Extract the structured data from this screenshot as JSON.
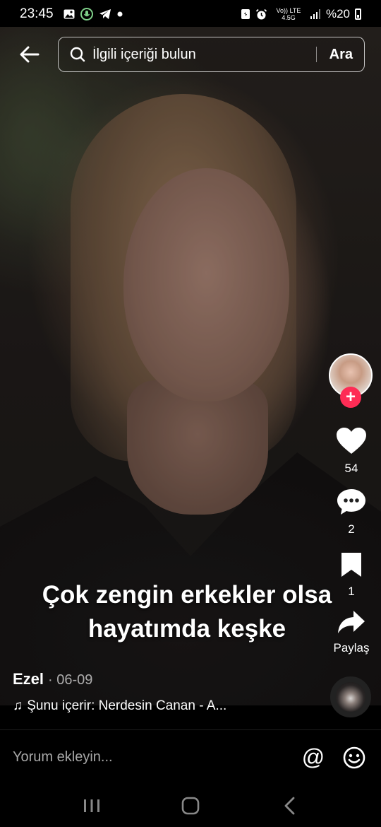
{
  "status_bar": {
    "time": "23:45",
    "network": "Vo)) LTE 4.5G",
    "battery": "%20"
  },
  "search": {
    "placeholder": "İlgili içeriği bulun",
    "button_label": "Ara"
  },
  "actions": {
    "likes": "54",
    "comments": "2",
    "bookmarks": "1",
    "share_label": "Paylaş"
  },
  "caption": {
    "line1": "Çok zengin erkekler olsa",
    "line2": "hayatımda keşke"
  },
  "post": {
    "author": "Ezel",
    "date": "· 06-09",
    "music": "Şunu içerir: Nerdesin Canan - A..."
  },
  "comment": {
    "placeholder": "Yorum ekleyin..."
  },
  "colors": {
    "follow_accent": "#fe2c55",
    "background": "#000000"
  }
}
